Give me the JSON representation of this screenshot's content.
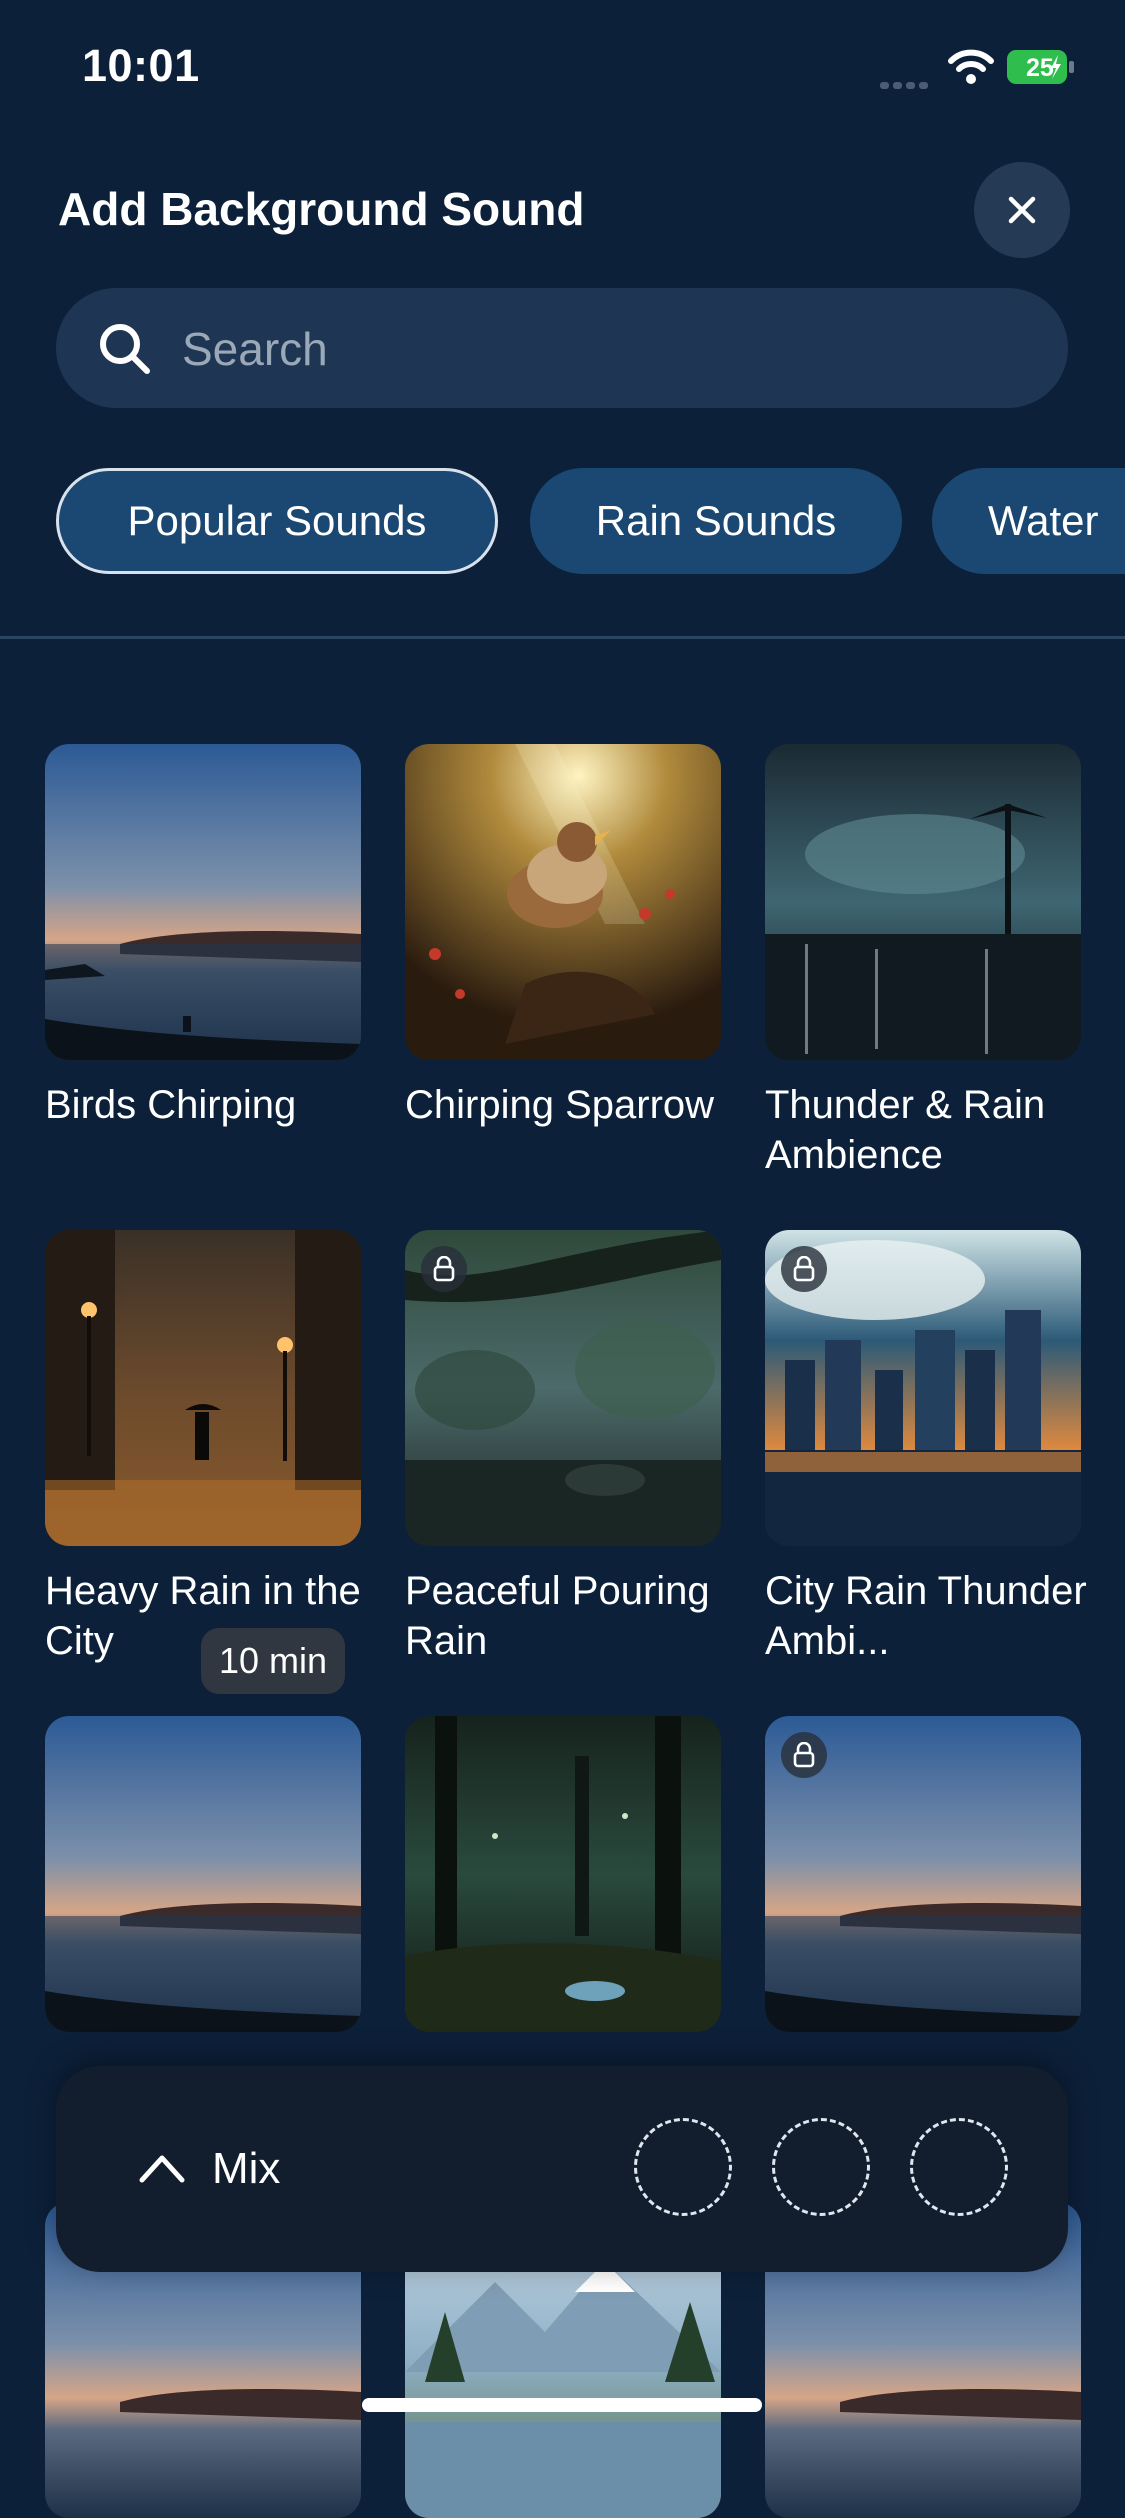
{
  "status_bar": {
    "time": "10:01",
    "battery": "25"
  },
  "header": {
    "title": "Add Background Sound",
    "close_icon": "close-icon"
  },
  "search": {
    "placeholder": "Search",
    "value": "",
    "icon": "search-icon"
  },
  "categories": [
    {
      "label": "Popular Sounds",
      "selected": true
    },
    {
      "label": "Rain Sounds",
      "selected": false
    },
    {
      "label": "Water",
      "selected": false
    }
  ],
  "sounds": [
    {
      "title": "Birds Chirping",
      "locked": false,
      "duration": ""
    },
    {
      "title": "Chirping Sparrow",
      "locked": false,
      "duration": ""
    },
    {
      "title": "Thunder & Rain Ambience",
      "locked": false,
      "duration": ""
    },
    {
      "title": "Heavy Rain in the City",
      "locked": false,
      "duration": ""
    },
    {
      "title": "Peaceful Pouring Rain",
      "locked": true,
      "duration": ""
    },
    {
      "title": "City Rain Thunder Ambi...",
      "locked": true,
      "duration": ""
    },
    {
      "title": "",
      "locked": false,
      "duration": "10 min"
    },
    {
      "title": "",
      "locked": false,
      "duration": ""
    },
    {
      "title": "",
      "locked": true,
      "duration": ""
    },
    {
      "title": "",
      "locked": false,
      "duration": ""
    },
    {
      "title": "",
      "locked": false,
      "duration": ""
    },
    {
      "title": "",
      "locked": false,
      "duration": ""
    }
  ],
  "mix": {
    "label": "Mix",
    "empty_slots": 3
  },
  "colors": {
    "background": "#0c2039",
    "chip": "#1b4872",
    "search": "#1e3653",
    "mix_bar": "#121e2e"
  }
}
